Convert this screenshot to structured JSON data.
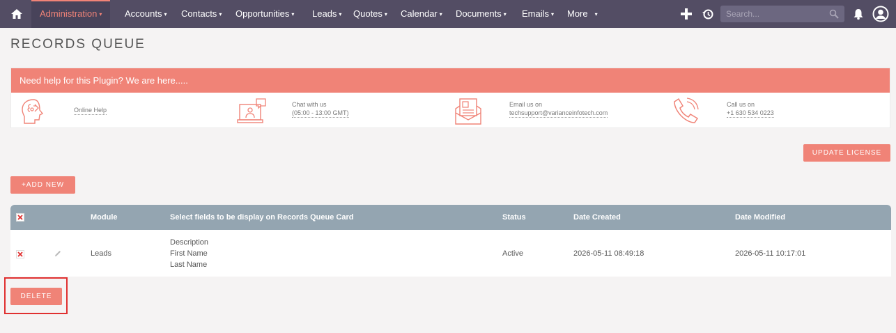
{
  "nav": {
    "items": [
      {
        "label": "Administration",
        "caret": "▾"
      },
      {
        "label": "Accounts",
        "caret": "▾"
      },
      {
        "label": "Contacts",
        "caret": "▾"
      },
      {
        "label": "Opportunities",
        "caret": "▾"
      },
      {
        "label": "Leads",
        "caret": "▾"
      },
      {
        "label": "Quotes",
        "caret": "▾"
      },
      {
        "label": "Calendar",
        "caret": "▾"
      },
      {
        "label": "Documents",
        "caret": "▾"
      },
      {
        "label": "Emails",
        "caret": "▾"
      },
      {
        "label": "More",
        "caret": "▾"
      }
    ],
    "search_placeholder": "Search...",
    "colors": {
      "bar": "#534d64",
      "accent": "#f08377"
    }
  },
  "page_title": "RECORDS QUEUE",
  "help": {
    "heading": "Need help for this Plugin? We are here.....",
    "online_help": "Online Help",
    "chat_line1": "Chat with us",
    "chat_line2": "(05:00 - 13:00 GMT)",
    "email_line1": "Email us on",
    "email_line2": "techsupport@varianceinfotech.com",
    "call_line1": "Call us on",
    "call_line2": "+1 630 534 0223"
  },
  "buttons": {
    "update_license": "UPDATE LICENSE",
    "add_new": "+ADD NEW",
    "delete": "DELETE"
  },
  "table": {
    "headers": {
      "module": "Module",
      "fields": "Select fields to be display on Records Queue Card",
      "status": "Status",
      "date_created": "Date Created",
      "date_modified": "Date Modified"
    },
    "rows": [
      {
        "module": "Leads",
        "fields": [
          "Description",
          "First Name",
          "Last Name"
        ],
        "status": "Active",
        "date_created": "2026-05-11 08:49:18",
        "date_modified": "2026-05-11 10:17:01"
      }
    ]
  }
}
